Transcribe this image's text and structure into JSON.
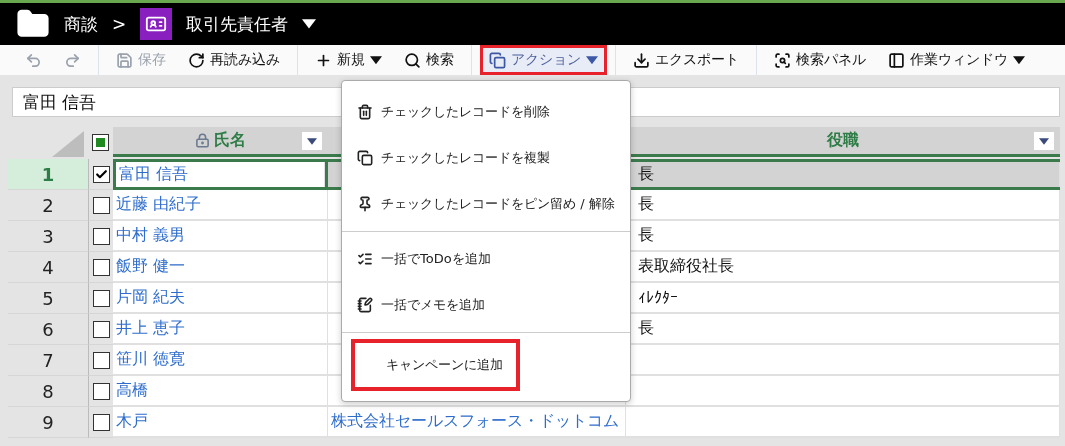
{
  "breadcrumb": {
    "module": "商談",
    "separator": ">",
    "current": "取引先責任者"
  },
  "toolbar": [
    [
      {
        "kind": "undo",
        "disabled": true,
        "selected": false,
        "highlighted": false
      },
      {
        "kind": "redo",
        "disabled": true,
        "selected": false,
        "highlighted": false
      }
    ],
    [
      {
        "kind": "save",
        "label": "保存",
        "disabled": true,
        "selected": false,
        "highlighted": false
      },
      {
        "kind": "reload",
        "label": "再読み込み",
        "disabled": false,
        "selected": false,
        "highlighted": false
      }
    ],
    [
      {
        "kind": "new",
        "label": "新規",
        "disabled": false,
        "selected": false,
        "highlighted": false,
        "dropdown": true
      },
      {
        "kind": "search",
        "label": "検索",
        "disabled": false,
        "selected": false,
        "highlighted": false
      }
    ],
    [
      {
        "kind": "action",
        "label": "アクション",
        "disabled": false,
        "selected": true,
        "highlighted": true,
        "dropdown": true
      }
    ],
    [
      {
        "kind": "export",
        "label": "エクスポート",
        "disabled": false,
        "selected": false,
        "highlighted": false
      }
    ],
    [
      {
        "kind": "panel",
        "label": "検索パネル",
        "disabled": false,
        "selected": false,
        "highlighted": false
      },
      {
        "kind": "window",
        "label": "作業ウィンドウ",
        "disabled": false,
        "selected": false,
        "highlighted": false,
        "dropdown": true
      }
    ]
  ],
  "search_field": {
    "value": "富田 信吾"
  },
  "table": {
    "select_all_partial": true,
    "columns": [
      {
        "label": "氏名",
        "locked": true
      },
      {},
      {
        "label": "役職",
        "locked": false
      }
    ],
    "rows": [
      {
        "number": "1",
        "checked": true,
        "selected": true,
        "name": "富田 信吾",
        "role": "長"
      },
      {
        "number": "2",
        "checked": false,
        "selected": false,
        "name": "近藤 由紀子",
        "role": "長"
      },
      {
        "number": "3",
        "checked": false,
        "selected": false,
        "name": "中村 義男",
        "role": "長"
      },
      {
        "number": "4",
        "checked": false,
        "selected": false,
        "name": "飯野 健一",
        "role": "表取締役社長"
      },
      {
        "number": "5",
        "checked": false,
        "selected": false,
        "name": "片岡 紀夫",
        "role": "ｨﾚｸﾀｰ"
      },
      {
        "number": "6",
        "checked": false,
        "selected": false,
        "name": "井上 恵子",
        "role": "長"
      },
      {
        "number": "7",
        "checked": false,
        "selected": false,
        "name": "笹川 徳寛"
      },
      {
        "number": "8",
        "checked": false,
        "selected": false,
        "name": "高橋"
      },
      {
        "number": "9",
        "checked": false,
        "selected": false,
        "name": "木戸",
        "company": "株式会社セールスフォース・ドットコム"
      }
    ]
  },
  "action_menu": {
    "groups": [
      [
        {
          "kind": "delete",
          "label": "チェックしたレコードを削除",
          "highlighted": false
        },
        {
          "kind": "copy",
          "label": "チェックしたレコードを複製",
          "highlighted": false
        },
        {
          "kind": "pin",
          "label": "チェックしたレコードをピン留め / 解除",
          "highlighted": false
        }
      ],
      [
        {
          "kind": "todo",
          "label": "一括でToDoを追加",
          "highlighted": false
        },
        {
          "kind": "memo",
          "label": "一括でメモを追加",
          "highlighted": false
        }
      ],
      [
        {
          "kind": "campaign",
          "label": "キャンペーンに追加",
          "highlighted": true
        }
      ]
    ]
  }
}
